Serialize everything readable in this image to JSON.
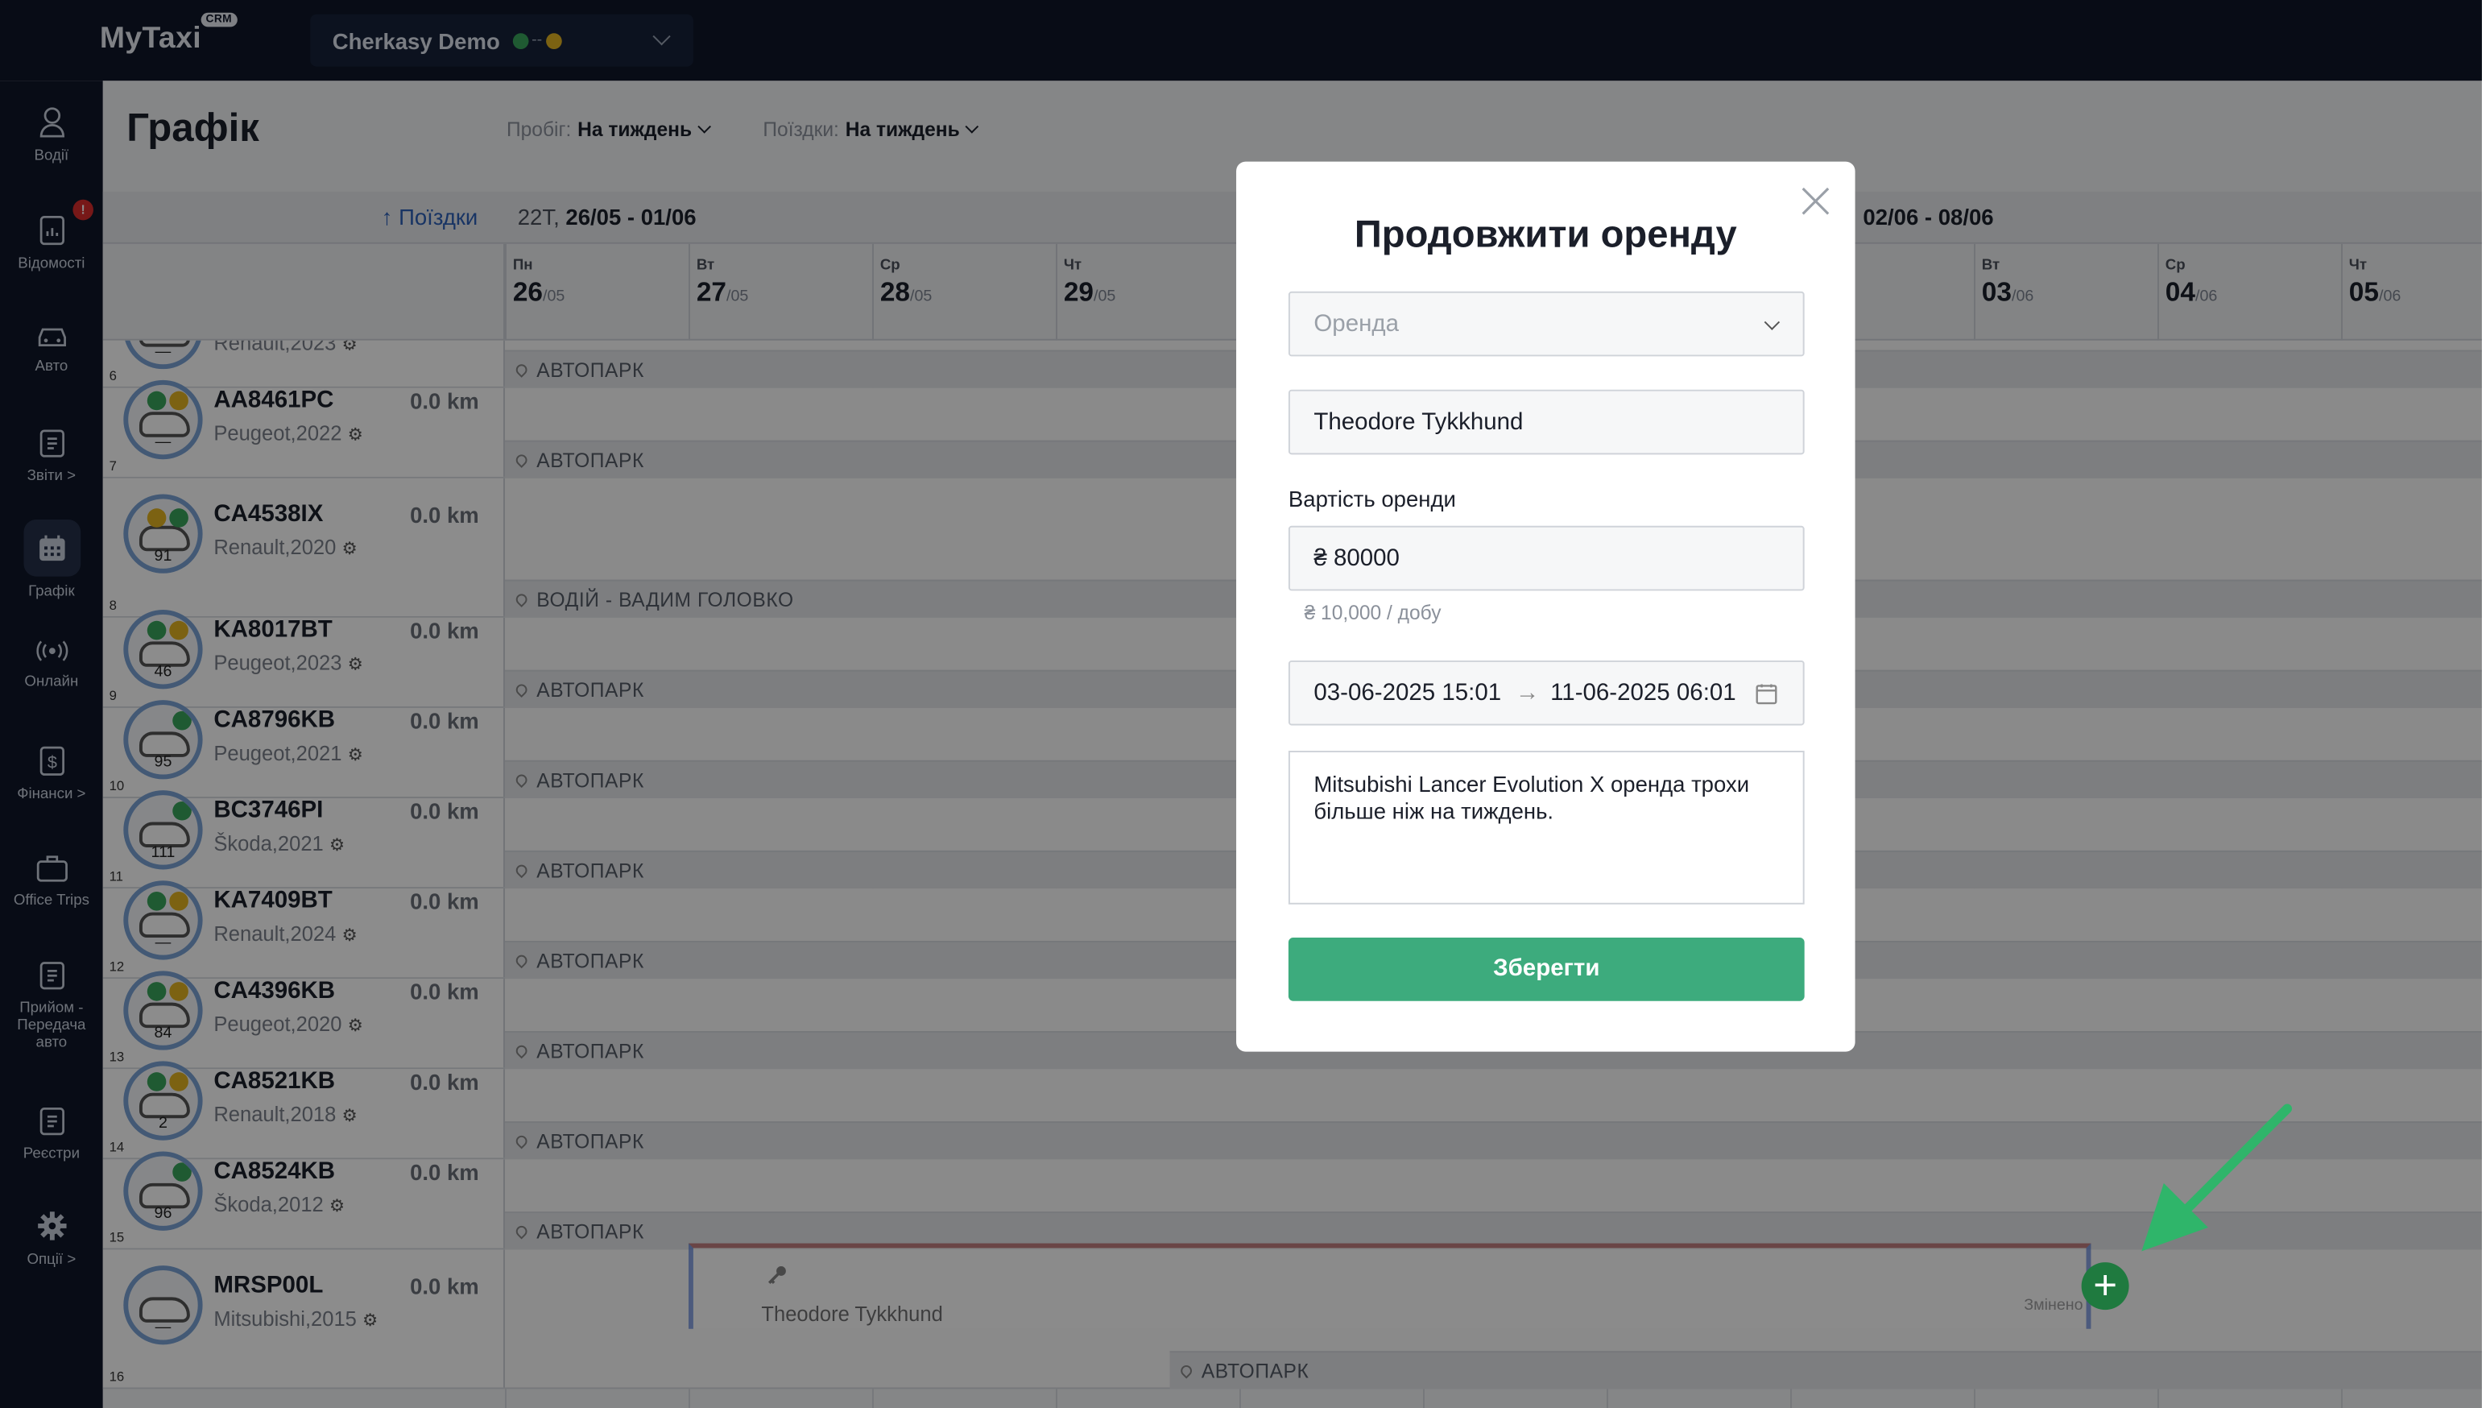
{
  "app": {
    "logo": "MyTaxi",
    "logo_badge": "CRM",
    "company": "Cherkasy Demo",
    "company_separator": "--"
  },
  "sidebar": {
    "items": [
      {
        "label": "Водії",
        "icon": "user-icon"
      },
      {
        "label": "Відомості",
        "icon": "report-icon",
        "badge": "!"
      },
      {
        "label": "Авто",
        "icon": "car-icon"
      },
      {
        "label": "Звіти >",
        "icon": "clipboard-icon"
      },
      {
        "label": "Графік",
        "icon": "calendar-icon",
        "active": true
      },
      {
        "label": "Онлайн",
        "icon": "broadcast-icon"
      },
      {
        "label": "Фінанси >",
        "icon": "dollar-doc-icon"
      },
      {
        "label": "Office Trips",
        "icon": "briefcase-icon"
      },
      {
        "label": "Прийом - Передача авто",
        "icon": "clipboard-icon"
      },
      {
        "label": "Реєстри",
        "icon": "clipboard-icon"
      },
      {
        "label": "Опції >",
        "icon": "gear-icon"
      }
    ]
  },
  "page": {
    "title": "Графік",
    "filter_mileage_label": "Пробіг:",
    "filter_mileage_value": "На тиждень",
    "filter_trips_label": "Поїздки:",
    "filter_trips_value": "На тиждень"
  },
  "schedule": {
    "trips_link": "↑ Поїздки",
    "week1_prefix": "22Т,",
    "week1_range": "26/05 - 01/06",
    "week2_range": "02/06 - 08/06",
    "days": [
      {
        "name": "Пн",
        "num": "26",
        "month": "/05"
      },
      {
        "name": "Вт",
        "num": "27",
        "month": "/05"
      },
      {
        "name": "Ср",
        "num": "28",
        "month": "/05"
      },
      {
        "name": "Чт",
        "num": "29",
        "month": "/05"
      },
      {
        "name": "",
        "num": "",
        "month": ""
      },
      {
        "name": "",
        "num": "",
        "month": ""
      },
      {
        "name": "",
        "num": "",
        "month": ""
      },
      {
        "name": "",
        "num": "",
        "month": ""
      },
      {
        "name": "Вт",
        "num": "03",
        "month": "/06"
      },
      {
        "name": "Ср",
        "num": "04",
        "month": "/06"
      },
      {
        "name": "Чт",
        "num": "05",
        "month": "/06"
      }
    ],
    "rows": [
      {
        "n": "6",
        "plate": "",
        "km": "",
        "model": "Renault,2023",
        "avatar_num": "—",
        "strip": "АВТОПАРК"
      },
      {
        "n": "7",
        "plate": "AA8461PC",
        "km": "0.0 km",
        "model": "Peugeot,2022",
        "avatar_num": "—",
        "strip": "АВТОПАРК"
      },
      {
        "n": "8",
        "plate": "CA4538IX",
        "km": "0.0 km",
        "model": "Renault,2020",
        "avatar_num": "91",
        "strip": "ВОДІЙ - ВАДИМ ГОЛОВКО"
      },
      {
        "n": "9",
        "plate": "KA8017BT",
        "km": "0.0 km",
        "model": "Peugeot,2023",
        "avatar_num": "46",
        "strip": "АВТОПАРК"
      },
      {
        "n": "10",
        "plate": "CA8796KB",
        "km": "0.0 km",
        "model": "Peugeot,2021",
        "avatar_num": "95",
        "strip": "АВТОПАРК"
      },
      {
        "n": "11",
        "plate": "BC3746PI",
        "km": "0.0 km",
        "model": "Škoda,2021",
        "avatar_num": "111",
        "strip": "АВТОПАРК"
      },
      {
        "n": "12",
        "plate": "KA7409BT",
        "km": "0.0 km",
        "model": "Renault,2024",
        "avatar_num": "—",
        "strip": "АВТОПАРК"
      },
      {
        "n": "13",
        "plate": "CA4396KB",
        "km": "0.0 km",
        "model": "Peugeot,2020",
        "avatar_num": "84",
        "strip": "АВТОПАРК"
      },
      {
        "n": "14",
        "plate": "CA8521KB",
        "km": "0.0 km",
        "model": "Renault,2018",
        "avatar_num": "2",
        "strip": "АВТОПАРК"
      },
      {
        "n": "15",
        "plate": "CA8524KB",
        "km": "0.0 km",
        "model": "Škoda,2012",
        "avatar_num": "96",
        "strip": "АВТОПАРК"
      },
      {
        "n": "16",
        "plate": "MRSP00L",
        "km": "0.0 km",
        "model": "Mitsubishi,2015",
        "avatar_num": "—",
        "strip": "АВТОПАРК"
      }
    ],
    "booking": {
      "name": "Theodore Tykkhund",
      "changed": "Змінено"
    }
  },
  "modal": {
    "title": "Продовжити оренду",
    "type_placeholder": "Оренда",
    "driver": "Theodore Tykkhund",
    "cost_label": "Вартість оренди",
    "cost_value": "₴ 80000",
    "cost_hint": "₴ 10,000 / добу",
    "date_from": "03-06-2025 15:01",
    "date_arrow": "→",
    "date_to": "11-06-2025 06:01",
    "comment": "Mitsubishi Lancer Evolution X оренда трохи більше ніж на тиждень.",
    "save": "Зберегти"
  },
  "colors": {
    "accent_green": "#3dab7d",
    "nav_bg": "#0f1729",
    "link_blue": "#2c5fb7",
    "annotation_arrow": "#2fb56a"
  }
}
